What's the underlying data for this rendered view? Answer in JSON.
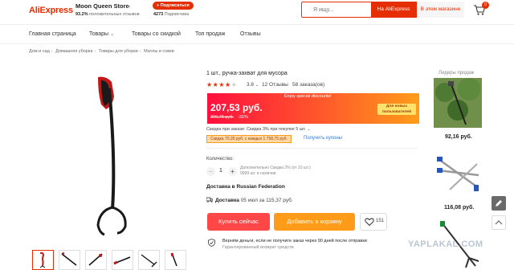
{
  "header": {
    "logo": "AliExpress",
    "store": {
      "name": "Moon Queen Store",
      "rating": "93.2%",
      "rating_label": "положительных отзывов",
      "subscribers": "4273",
      "subscribers_label": "Подписчика",
      "subscribe_label": "+ Подписаться"
    },
    "search": {
      "placeholder": "Я ищу...",
      "btn_aliexpress": "На AliExpress",
      "btn_store": "В этом магазине"
    },
    "cart_count": "0"
  },
  "nav": {
    "items": [
      "Главная страница",
      "Товары",
      "Товары со скидкой",
      "Топ продаж",
      "Отзывы"
    ]
  },
  "breadcrumb": [
    "Дом и сад",
    "Домашняя уборка",
    "Товары для уборки",
    "Матлы и совки"
  ],
  "product": {
    "title": "1 шт., ручка-захват для мусора",
    "stars_filled": "★★★★",
    "stars_empty": "★",
    "rating": "3.8",
    "reviews": "12 Отзывы",
    "orders": "58 заказа(ов)",
    "promo_banner": "Enjoy special discounts!",
    "price": "207,53 руб.",
    "old_price": "300,78 руб.",
    "discount": "-31%",
    "newbie": "Для новых пользователей",
    "tier_discount": "Скидка при заказе: Скидка 3% при покупке 5 шт.",
    "coupon": "Скидка 70,35 руб. с каждых 1 758,75 руб.",
    "get_coupons": "Получить купоны",
    "quantity_label": "Количество:",
    "quantity": "1",
    "qty_note1": "Дополнительно Скидка 2% (от 10 шт.)",
    "qty_note2": "9999 шт. в наличии",
    "ship_to": "Доставка в Russian Federation",
    "delivery_label": "Доставка",
    "delivery_text": "05 июл за 115,37 руб.",
    "buy_now": "Купить сейчас",
    "add_to_cart": "Добавить в корзину",
    "wishlist_count": "151",
    "guarantee_title": "Вернём деньги, если не получите заказ через 90 дней после отправки",
    "guarantee_sub": "Гарантированный возврат средств"
  },
  "sidebar": {
    "title": "Лидеры продаж",
    "price1": "92,16 руб.",
    "price2": "116,08 руб."
  },
  "watermark": "YAPLAKAL.COM",
  "colors": {
    "brand": "#e62e04",
    "buy": "#ff4747",
    "cart": "#ff9b18",
    "link": "#2a7ae2"
  }
}
